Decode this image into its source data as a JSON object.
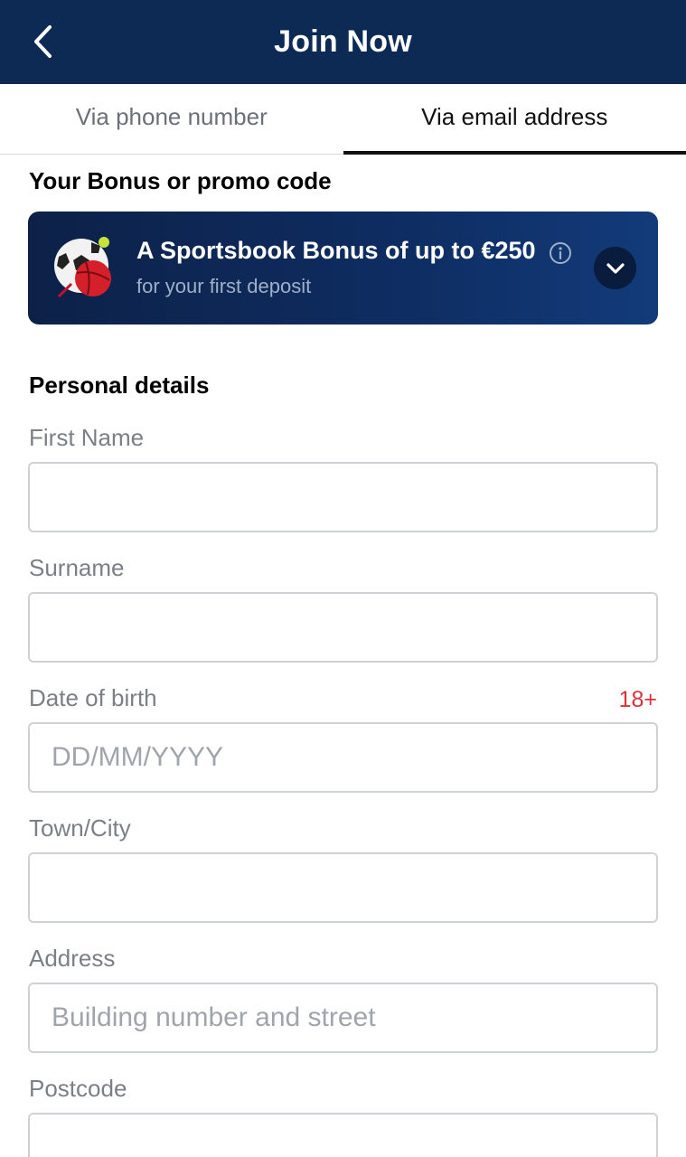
{
  "header": {
    "title": "Join Now"
  },
  "tabs": [
    {
      "label": "Via phone number",
      "active": false
    },
    {
      "label": "Via email address",
      "active": true
    }
  ],
  "bonus_section": {
    "title": "Your Bonus or promo code",
    "card": {
      "title": "A Sportsbook Bonus of up to €250",
      "subtitle": "for your first deposit",
      "icon": "sports-ball-icon"
    }
  },
  "personal_details": {
    "title": "Personal details",
    "fields": {
      "first_name": {
        "label": "First Name",
        "placeholder": "",
        "value": ""
      },
      "surname": {
        "label": "Surname",
        "placeholder": "",
        "value": ""
      },
      "dob": {
        "label": "Date of birth",
        "badge": "18+",
        "placeholder": "DD/MM/YYYY",
        "value": ""
      },
      "town": {
        "label": "Town/City",
        "placeholder": "",
        "value": ""
      },
      "address": {
        "label": "Address",
        "placeholder": "Building number and street",
        "value": ""
      },
      "postcode": {
        "label": "Postcode",
        "placeholder": "",
        "value": ""
      }
    }
  },
  "colors": {
    "header_bg": "#0d2a55",
    "accent_red": "#d8323c",
    "active_tab_underline": "#111111"
  }
}
